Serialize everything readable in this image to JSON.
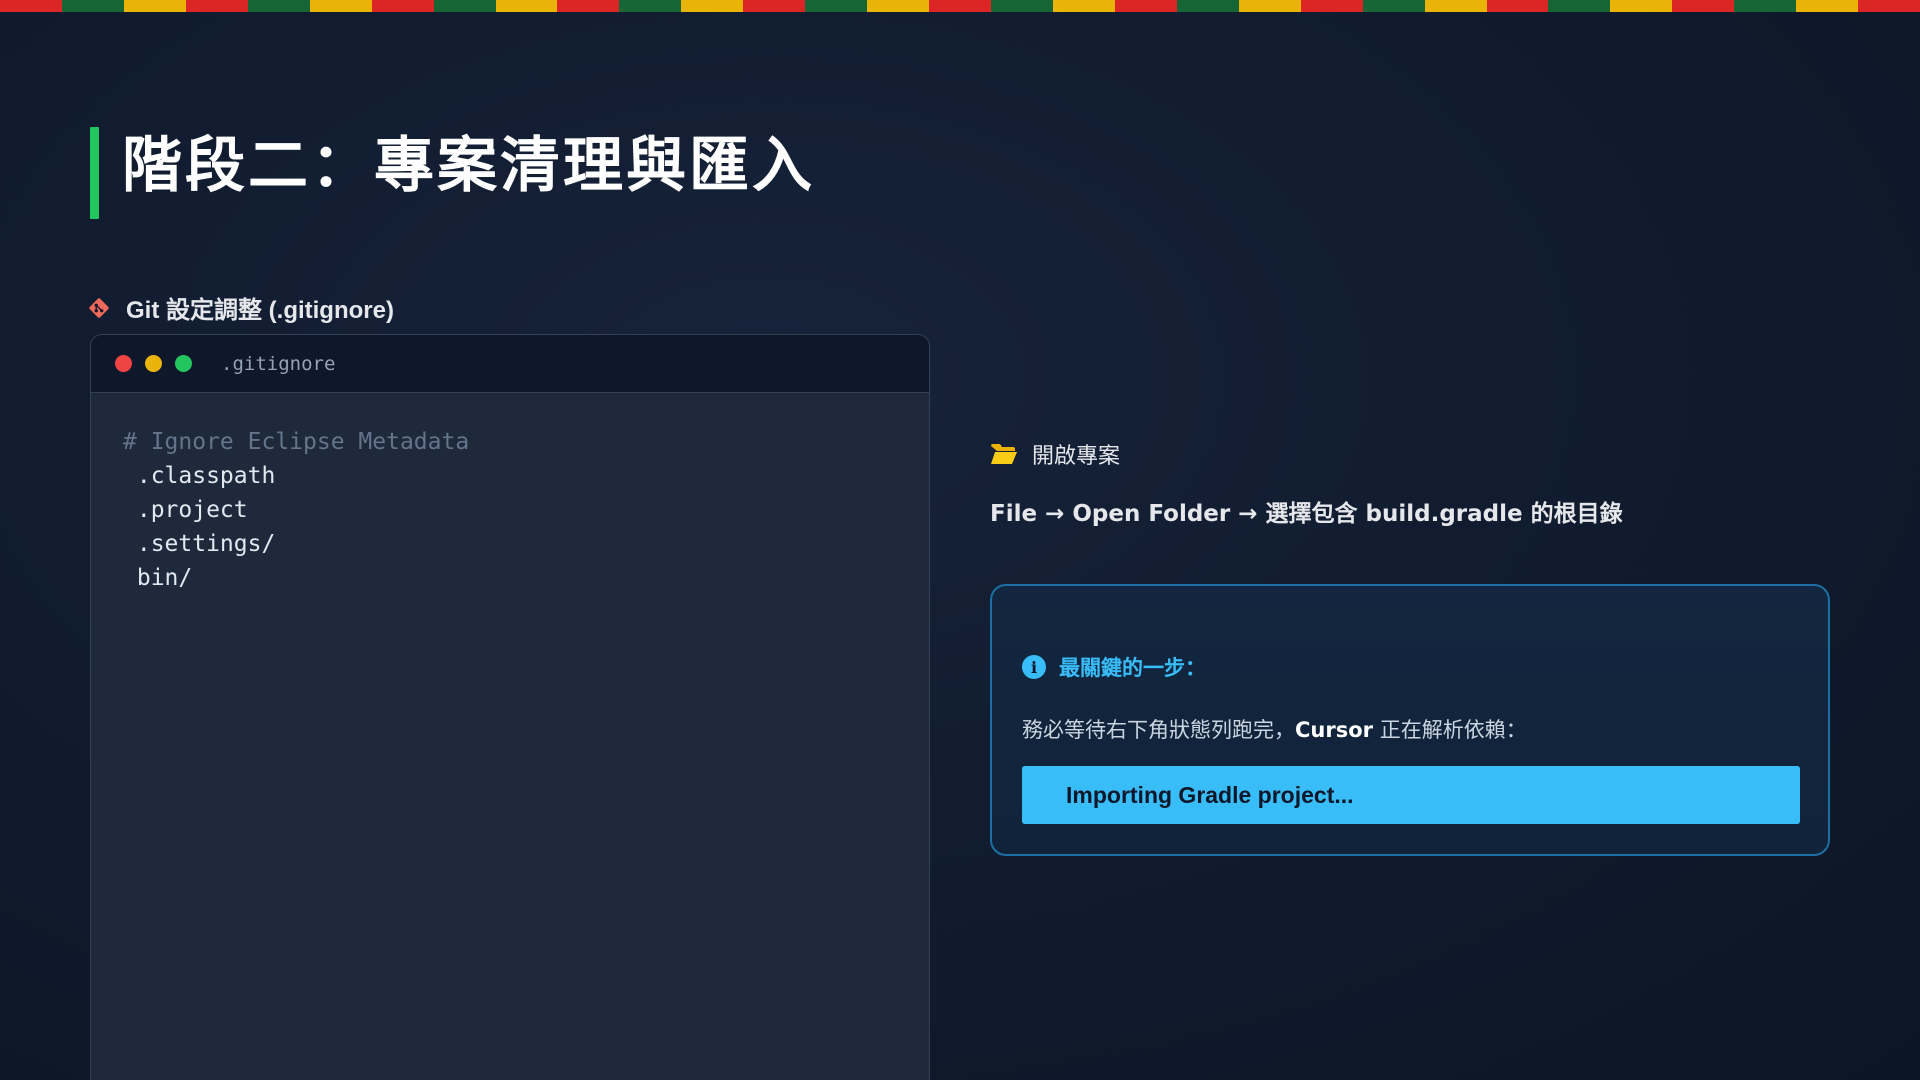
{
  "decoration": {
    "stripe_colors": [
      "#dc2626",
      "#166534",
      "#eab308",
      "#dc2626",
      "#166534",
      "#eab308",
      "#dc2626",
      "#166534",
      "#eab308",
      "#dc2626",
      "#166534",
      "#eab308",
      "#dc2626",
      "#166534",
      "#eab308",
      "#dc2626",
      "#166534",
      "#eab308",
      "#dc2626",
      "#166534",
      "#eab308",
      "#dc2626",
      "#166534",
      "#eab308",
      "#dc2626",
      "#166534",
      "#eab308",
      "#dc2626",
      "#166534",
      "#eab308",
      "#dc2626"
    ]
  },
  "slide": {
    "title": "階段二：專案清理與匯入",
    "accent_color": "#22c55e"
  },
  "git_section": {
    "icon": "git-icon",
    "heading": "Git 設定調整 (.gitignore)"
  },
  "code_window": {
    "filename": ".gitignore",
    "lines": [
      {
        "text": "# Ignore Eclipse Metadata",
        "kind": "comment"
      },
      {
        "text": " .classpath",
        "kind": "code"
      },
      {
        "text": " .project",
        "kind": "code"
      },
      {
        "text": " .settings/",
        "kind": "code"
      },
      {
        "text": " bin/",
        "kind": "code"
      }
    ]
  },
  "open_section": {
    "icon": "open-folder-icon",
    "heading": "開啟專案",
    "path_text": "File → Open Folder → 選擇包含 build.gradle 的根目錄"
  },
  "callout": {
    "icon": "info-icon",
    "title": "最關鍵的一步：",
    "desc_before": "務必等待右下角狀態列跑完，",
    "desc_bold": "Cursor",
    "desc_after": " 正在解析依賴：",
    "progress_label": "Importing Gradle project...",
    "progress_value": 1.0,
    "accent_color": "#38bdf8"
  }
}
